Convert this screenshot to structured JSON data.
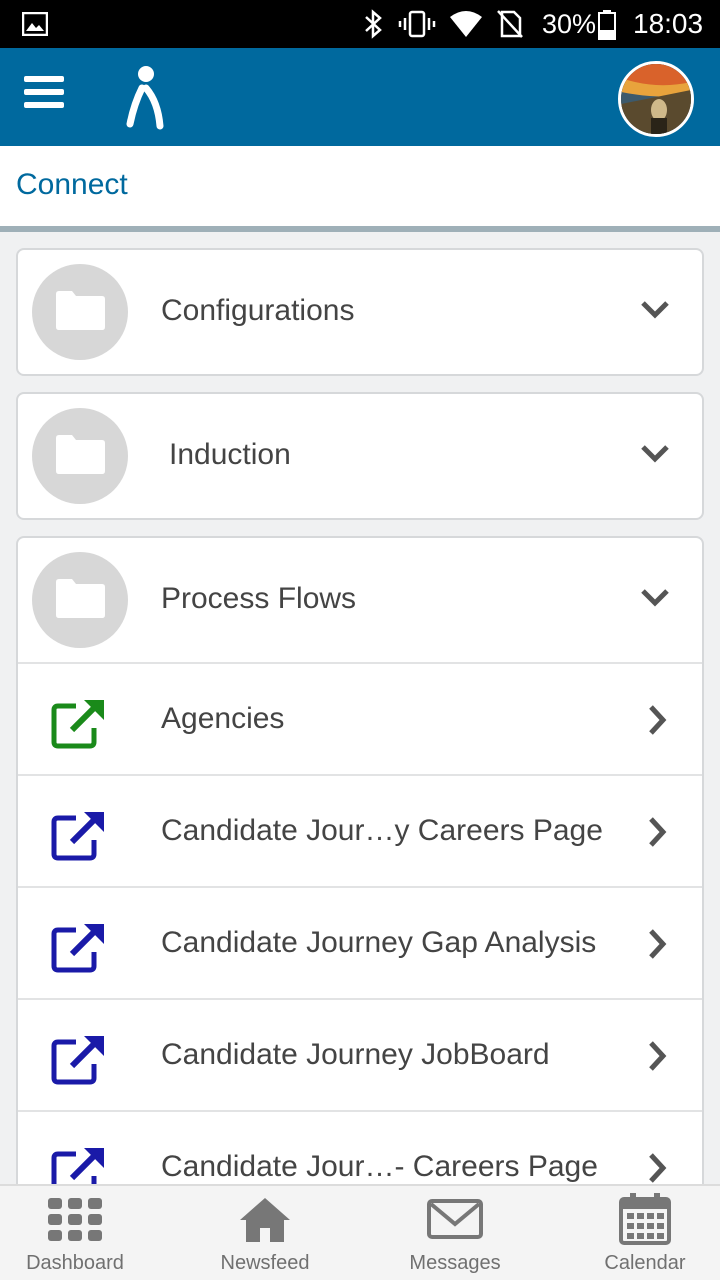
{
  "status_bar": {
    "battery": "30%",
    "time": "18:03"
  },
  "header": {
    "menu_icon": "hamburger-menu-icon",
    "logo_icon": "person-logo-icon",
    "avatar": "user-avatar"
  },
  "page": {
    "title": "Connect"
  },
  "folders": [
    {
      "label": "Configurations",
      "expanded": false
    },
    {
      "label": "Induction",
      "expanded": false
    },
    {
      "label": "Process Flows",
      "expanded": true
    }
  ],
  "process_flows": {
    "items": [
      {
        "label": "Agencies",
        "icon_color": "#1a8a1a"
      },
      {
        "label": "Candidate Jour…y Careers Page",
        "icon_color": "#1a1aa8"
      },
      {
        "label": "Candidate Journey Gap Analysis",
        "icon_color": "#1a1aa8"
      },
      {
        "label": "Candidate Journey JobBoard",
        "icon_color": "#1a1aa8"
      },
      {
        "label": "Candidate Jour…- Careers Page",
        "icon_color": "#1a1aa8"
      }
    ]
  },
  "bottom_nav": {
    "items": [
      {
        "label": "Dashboard",
        "icon": "grid-icon"
      },
      {
        "label": "Newsfeed",
        "icon": "home-icon"
      },
      {
        "label": "Messages",
        "icon": "envelope-icon"
      },
      {
        "label": "Calendar",
        "icon": "calendar-icon"
      }
    ]
  },
  "colors": {
    "header_bg": "#00699e",
    "title_color": "#00699e",
    "green_icon": "#1a8a1a",
    "blue_icon": "#1a1aa8"
  }
}
